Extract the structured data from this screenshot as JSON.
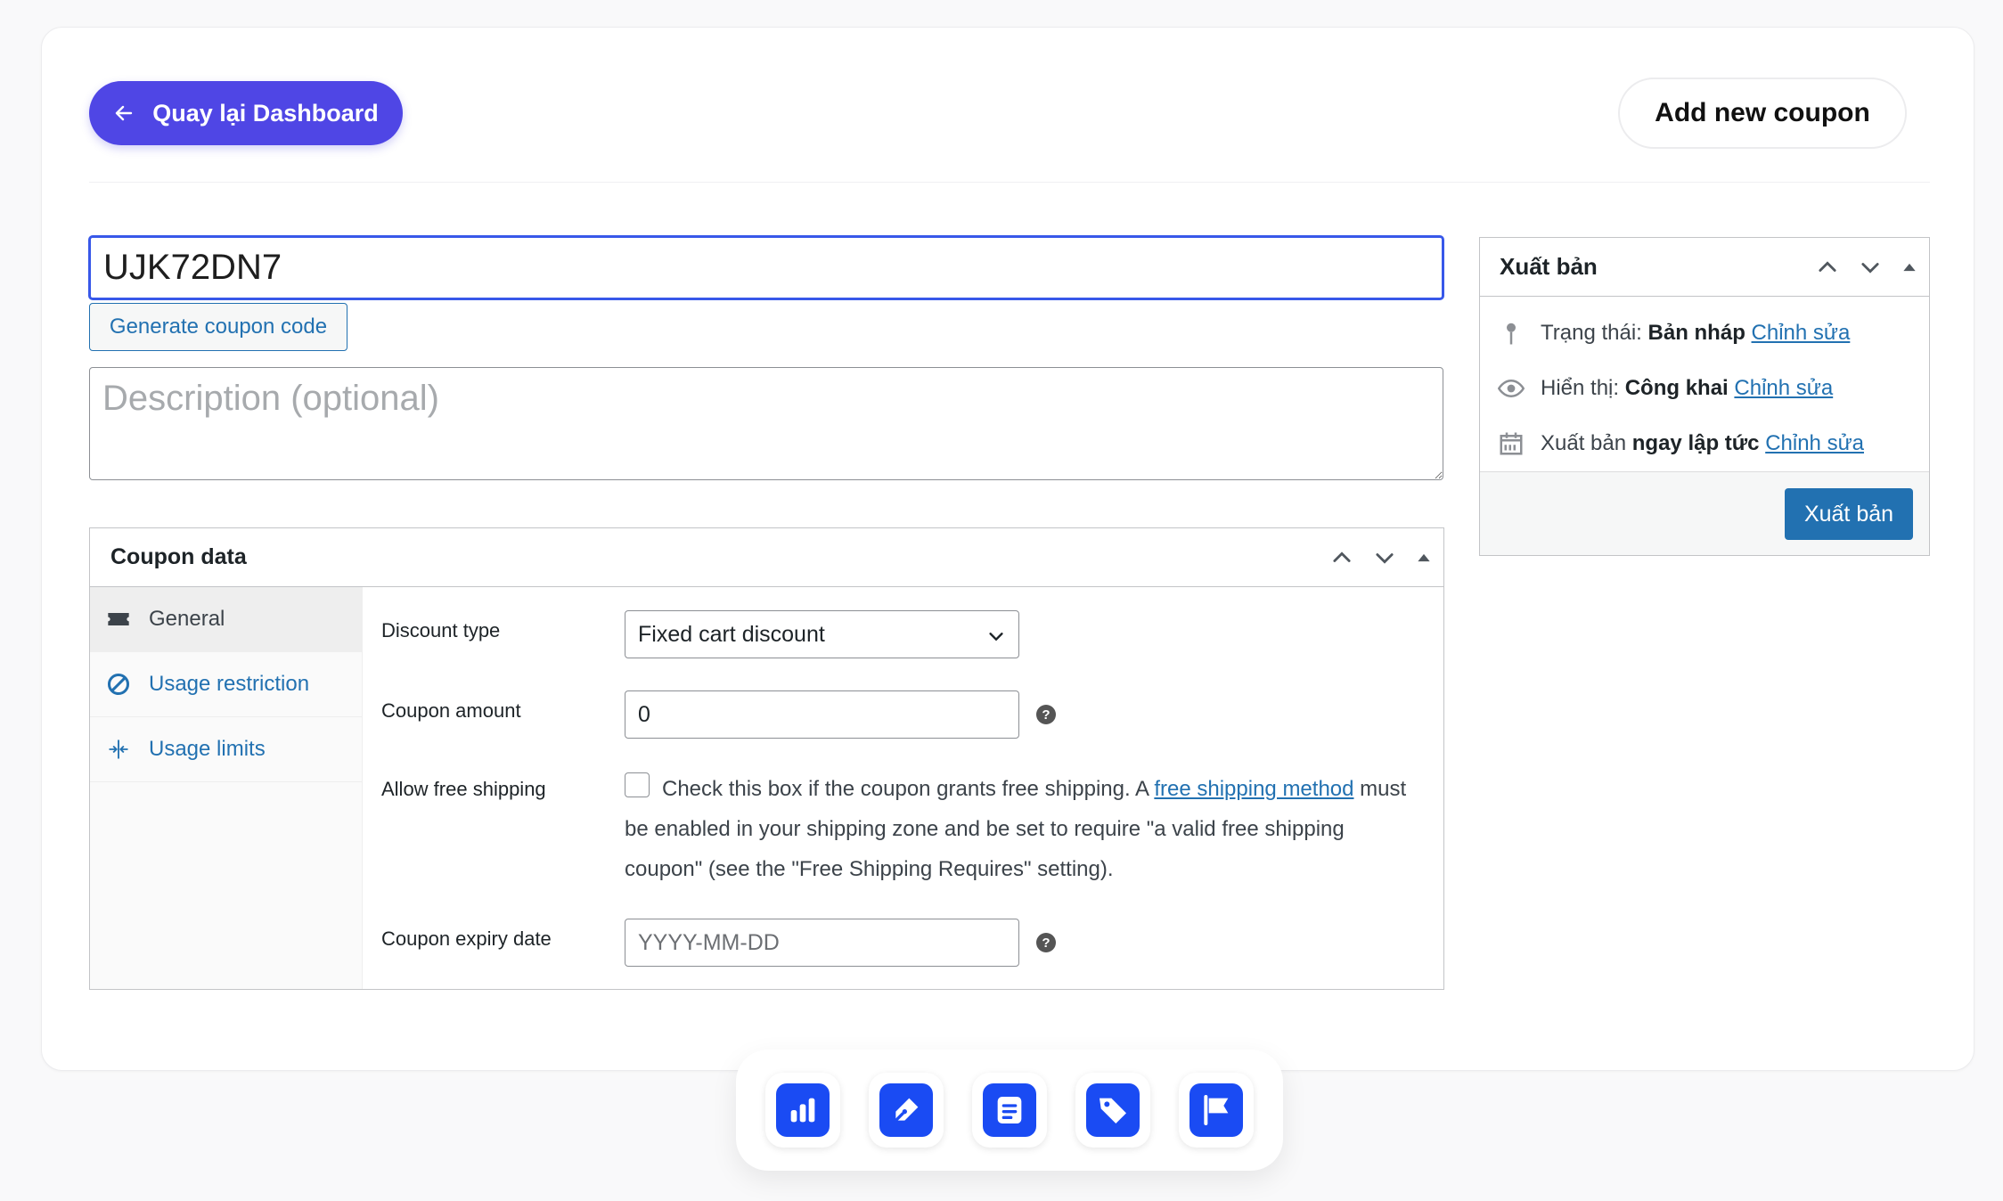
{
  "header": {
    "back_label": "Quay lại Dashboard",
    "add_label": "Add new coupon"
  },
  "coupon": {
    "code": "UJK72DN7",
    "generate_label": "Generate coupon code",
    "description_placeholder": "Description (optional)"
  },
  "coupon_data": {
    "title": "Coupon data",
    "tabs": [
      {
        "label": "General",
        "icon": "ticket-icon"
      },
      {
        "label": "Usage restriction",
        "icon": "block-icon"
      },
      {
        "label": "Usage limits",
        "icon": "limits-icon"
      }
    ],
    "discount_type": {
      "label": "Discount type",
      "value": "Fixed cart discount"
    },
    "coupon_amount": {
      "label": "Coupon amount",
      "value": "0"
    },
    "free_shipping": {
      "label": "Allow free shipping",
      "text_before": "Check this box if the coupon grants free shipping. A ",
      "link": "free shipping method",
      "text_after": " must be enabled in your shipping zone and be set to require \"a valid free shipping coupon\" (see the \"Free Shipping Requires\" setting)."
    },
    "expiry": {
      "label": "Coupon expiry date",
      "placeholder": "YYYY-MM-DD"
    }
  },
  "publish": {
    "title": "Xuất bản",
    "status_label": "Trạng thái:",
    "status_value": "Bản nháp",
    "visibility_label": "Hiển thị:",
    "visibility_value": "Công khai",
    "schedule_label": "Xuất bản",
    "schedule_value": "ngay lập tức",
    "edit_link": "Chỉnh sửa",
    "button": "Xuất bản"
  },
  "dock": {
    "items": [
      "chart-icon",
      "pen-icon",
      "document-icon",
      "tag-icon",
      "flag-icon"
    ]
  },
  "colors": {
    "primary": "#4f46e5",
    "wp_blue": "#2271b1",
    "dock_blue": "#1a4bf3"
  }
}
